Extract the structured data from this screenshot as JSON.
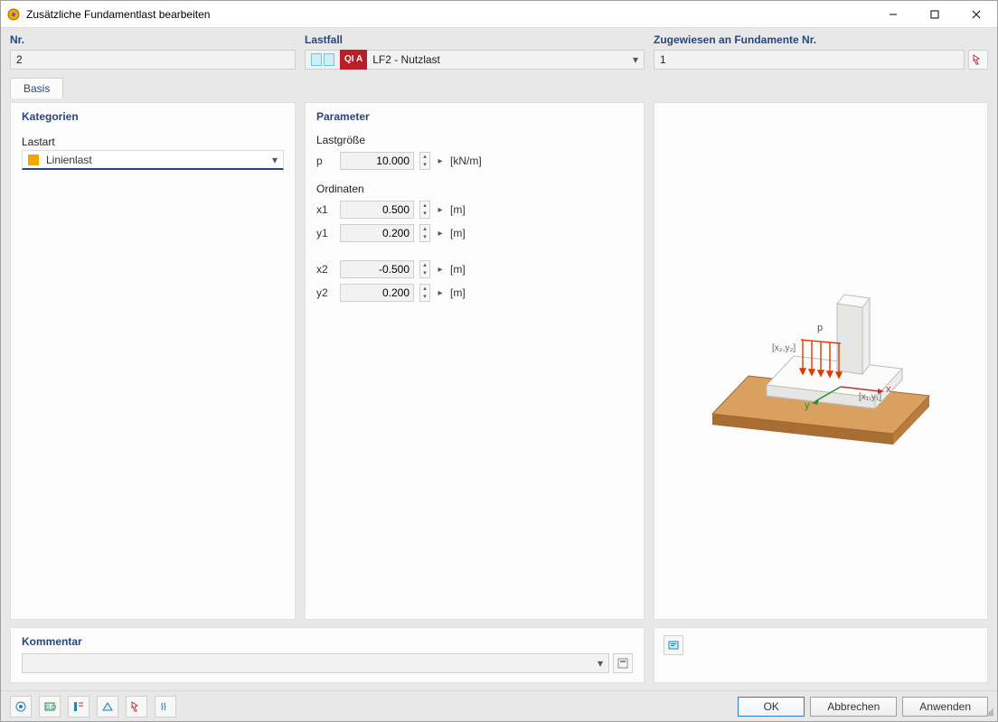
{
  "window": {
    "title": "Zusätzliche Fundamentlast bearbeiten"
  },
  "top": {
    "nr": {
      "label": "Nr.",
      "value": "2"
    },
    "lastfall": {
      "label": "Lastfall",
      "tag": "QI A",
      "value": "LF2 - Nutzlast"
    },
    "zugew": {
      "label": "Zugewiesen an Fundamente Nr.",
      "value": "1"
    }
  },
  "tabs": {
    "basis": "Basis"
  },
  "kategorien": {
    "title": "Kategorien",
    "lastart_label": "Lastart",
    "lastart_value": "Linienlast"
  },
  "parameter": {
    "title": "Parameter",
    "lastgroesse_label": "Lastgröße",
    "p_label": "p",
    "p_value": "10.000",
    "p_unit": "[kN/m]",
    "ordinaten_label": "Ordinaten",
    "x1_label": "x1",
    "x1_value": "0.500",
    "x1_unit": "[m]",
    "y1_label": "y1",
    "y1_value": "0.200",
    "y1_unit": "[m]",
    "x2_label": "x2",
    "x2_value": "-0.500",
    "x2_unit": "[m]",
    "y2_label": "y2",
    "y2_value": "0.200",
    "y2_unit": "[m]"
  },
  "preview": {
    "p": "p",
    "pt1": "[x₁,y₁]",
    "pt2": "[x₂,y₂]",
    "ax_x": "x",
    "ax_y": "y"
  },
  "kommentar": {
    "title": "Kommentar",
    "value": ""
  },
  "footer": {
    "ok": "OK",
    "cancel": "Abbrechen",
    "apply": "Anwenden"
  }
}
